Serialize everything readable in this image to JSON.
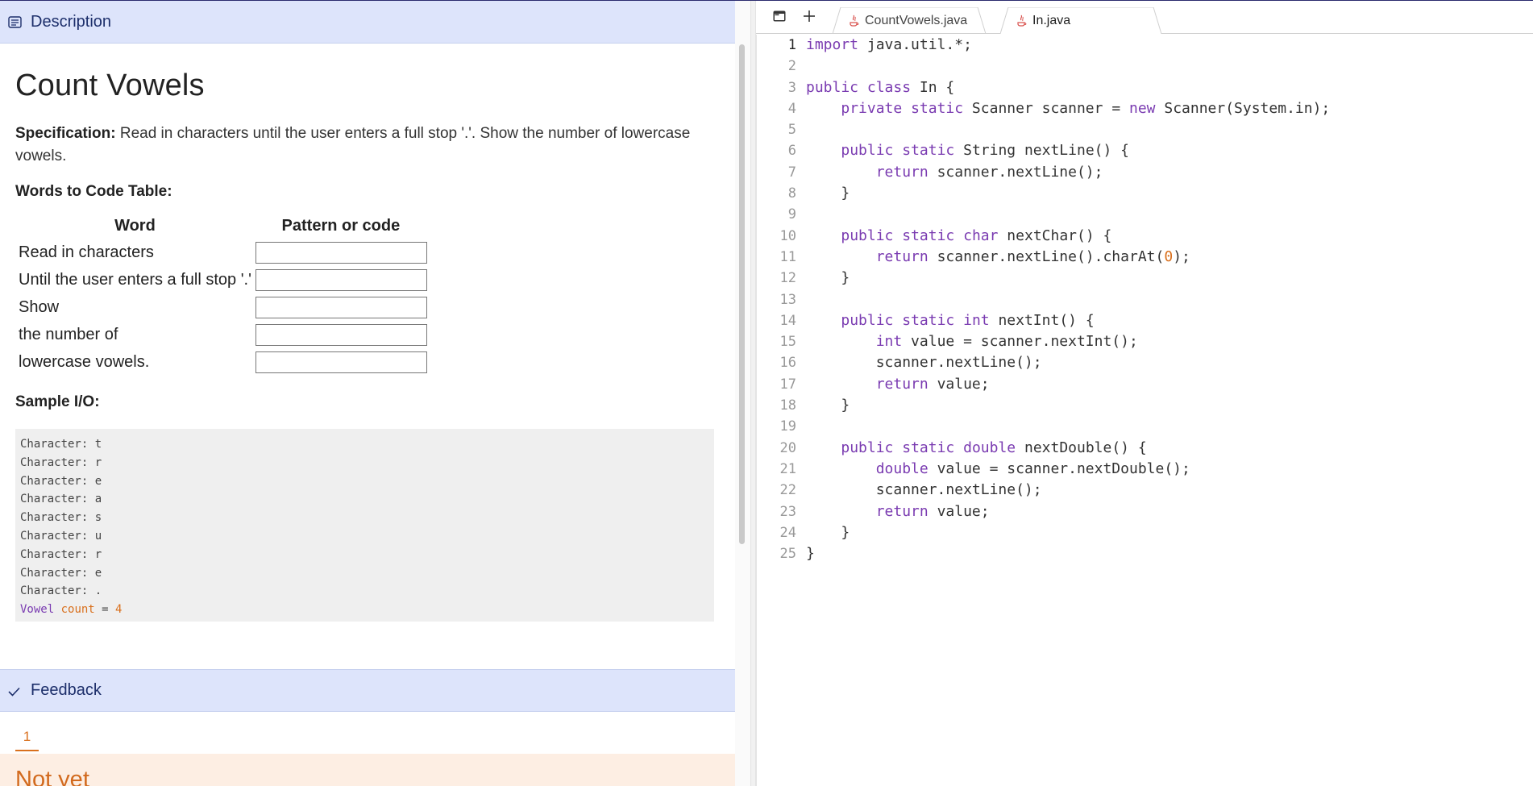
{
  "description_header": {
    "label": "Description",
    "icon": "description-icon"
  },
  "problem": {
    "title": "Count Vowels",
    "spec_label": "Specification:",
    "spec_text": " Read in characters until the user enters a full stop '.'. Show the number of lowercase vowels.",
    "words_heading": "Words to Code Table:",
    "table_headers": [
      "Word",
      "Pattern or code"
    ],
    "table_rows": [
      {
        "word": "Read in characters",
        "code": ""
      },
      {
        "word": "Until the user enters a full stop '.'",
        "code": ""
      },
      {
        "word": "Show",
        "code": ""
      },
      {
        "word": "the number of",
        "code": ""
      },
      {
        "word": "lowercase vowels.",
        "code": ""
      }
    ],
    "sample_heading": "Sample I/O:",
    "sample_lines": [
      "Character: t",
      "Character: r",
      "Character: e",
      "Character: a",
      "Character: s",
      "Character: u",
      "Character: r",
      "Character: e",
      "Character: ."
    ],
    "sample_result": {
      "word1": "Vowel",
      "word2": "count",
      "eq": " = ",
      "value": "4"
    }
  },
  "feedback": {
    "label": "Feedback",
    "icon": "checkmark-icon",
    "tab": "1",
    "status": "Not yet"
  },
  "editor": {
    "tabs": [
      {
        "label": "CountVowels.java",
        "active": false
      },
      {
        "label": "In.java",
        "active": true
      }
    ],
    "current_line": 1,
    "lines": [
      "import java.util.*;",
      "",
      "public class In {",
      "    private static Scanner scanner = new Scanner(System.in);",
      "",
      "    public static String nextLine() {",
      "        return scanner.nextLine();",
      "    }",
      "",
      "    public static char nextChar() {",
      "        return scanner.nextLine().charAt(0);",
      "    }",
      "",
      "    public static int nextInt() {",
      "        int value = scanner.nextInt();",
      "        scanner.nextLine();",
      "        return value;",
      "    }",
      "",
      "    public static double nextDouble() {",
      "        double value = scanner.nextDouble();",
      "        scanner.nextLine();",
      "        return value;",
      "    }",
      "}"
    ]
  },
  "colors": {
    "header_bg": "#dde4fb",
    "keyword": "#7a3bb1",
    "number": "#d9701d",
    "not_yet_bg": "#fdeee3"
  }
}
